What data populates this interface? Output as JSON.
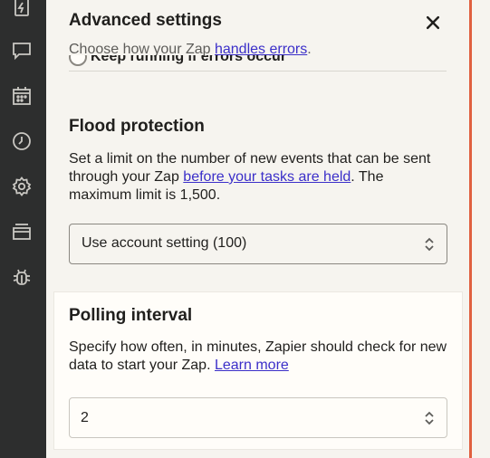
{
  "header": {
    "title": "Advanced settings",
    "subtitle_prefix": "Choose how your Zap ",
    "subtitle_link": "handles errors",
    "subtitle_suffix": "."
  },
  "error_option": {
    "label": "Keep running if errors occur"
  },
  "flood": {
    "title": "Flood protection",
    "text_prefix": "Set a limit on the number of new events that can be sent through your Zap ",
    "link": "before your tasks are held",
    "text_suffix": ". The maximum limit is 1,500.",
    "select_value": "Use account setting (100)"
  },
  "polling": {
    "title": "Polling interval",
    "text_prefix": "Specify how often, in minutes, Zapier should check for new data to start your Zap. ",
    "link": "Learn more",
    "value": "2"
  },
  "sidebar": {
    "icons": [
      "zap-bolt-icon",
      "chat-icon",
      "calendar-icon",
      "clock-icon",
      "gear-icon",
      "layers-icon",
      "bug-icon"
    ]
  },
  "colors": {
    "sidebar_bg": "#2d2e2e",
    "panel_bg": "#f6f4ef",
    "link": "#3b2fc9",
    "accent_edge": "#e0603f",
    "highlight_bg": "#fffdf9"
  }
}
